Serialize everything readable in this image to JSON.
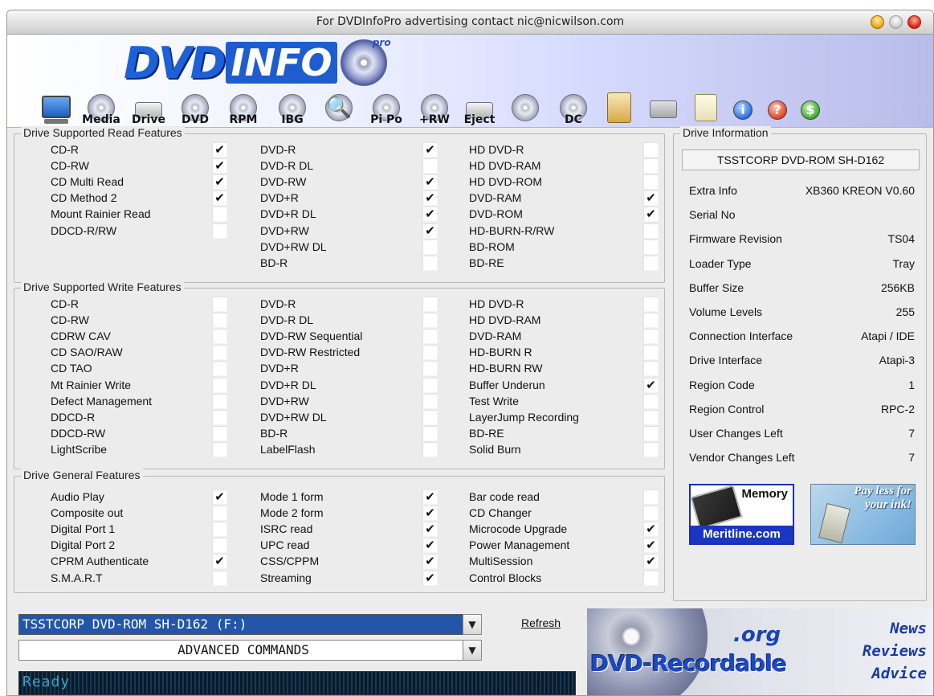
{
  "window": {
    "title": "For DVDInfoPro advertising contact nic@nicwilson.com"
  },
  "logo": {
    "dvd": "DVD",
    "info": "INFO",
    "pro": "pro"
  },
  "toolbar": {
    "media": "Media",
    "drive": "Drive",
    "dvd": "DVD",
    "rpm": "RPM",
    "ibg": "IBG",
    "pipo": "Pi Po",
    "rw": "+RW",
    "eject": "Eject",
    "dc": "DC"
  },
  "read": {
    "title": "Drive Supported Read Features",
    "col1": [
      {
        "label": "CD-R",
        "checked": true
      },
      {
        "label": "CD-RW",
        "checked": true
      },
      {
        "label": "CD Multi Read",
        "checked": true
      },
      {
        "label": "CD Method 2",
        "checked": true
      },
      {
        "label": "Mount Rainier Read",
        "checked": false
      },
      {
        "label": "DDCD-R/RW",
        "checked": false
      }
    ],
    "col2": [
      {
        "label": "DVD-R",
        "checked": true
      },
      {
        "label": "DVD-R DL",
        "checked": false
      },
      {
        "label": "DVD-RW",
        "checked": true
      },
      {
        "label": "DVD+R",
        "checked": true
      },
      {
        "label": "DVD+R DL",
        "checked": true
      },
      {
        "label": "DVD+RW",
        "checked": true
      },
      {
        "label": "DVD+RW DL",
        "checked": false
      },
      {
        "label": "BD-R",
        "checked": false
      }
    ],
    "col3": [
      {
        "label": "HD DVD-R",
        "checked": false
      },
      {
        "label": "HD DVD-RAM",
        "checked": false
      },
      {
        "label": "HD DVD-ROM",
        "checked": false
      },
      {
        "label": "DVD-RAM",
        "checked": true
      },
      {
        "label": "DVD-ROM",
        "checked": true
      },
      {
        "label": "HD-BURN-R/RW",
        "checked": false
      },
      {
        "label": "BD-ROM",
        "checked": false
      },
      {
        "label": "BD-RE",
        "checked": false
      }
    ]
  },
  "write": {
    "title": "Drive Supported Write Features",
    "col1": [
      {
        "label": "CD-R",
        "checked": false
      },
      {
        "label": "CD-RW",
        "checked": false
      },
      {
        "label": "CDRW CAV",
        "checked": false
      },
      {
        "label": "CD SAO/RAW",
        "checked": false
      },
      {
        "label": "CD TAO",
        "checked": false
      },
      {
        "label": "Mt Rainier Write",
        "checked": false
      },
      {
        "label": "Defect Management",
        "checked": false
      },
      {
        "label": "DDCD-R",
        "checked": false
      },
      {
        "label": "DDCD-RW",
        "checked": false
      },
      {
        "label": "LightScribe",
        "checked": false
      }
    ],
    "col2": [
      {
        "label": "DVD-R",
        "checked": false
      },
      {
        "label": "DVD-R DL",
        "checked": false
      },
      {
        "label": "DVD-RW Sequential",
        "checked": false
      },
      {
        "label": "DVD-RW Restricted",
        "checked": false
      },
      {
        "label": "DVD+R",
        "checked": false
      },
      {
        "label": "DVD+R DL",
        "checked": false
      },
      {
        "label": "DVD+RW",
        "checked": false
      },
      {
        "label": "DVD+RW DL",
        "checked": false
      },
      {
        "label": "BD-R",
        "checked": false
      },
      {
        "label": "LabelFlash",
        "checked": false
      }
    ],
    "col3": [
      {
        "label": "HD DVD-R",
        "checked": false
      },
      {
        "label": "HD DVD-RAM",
        "checked": false
      },
      {
        "label": "DVD-RAM",
        "checked": false
      },
      {
        "label": "HD-BURN R",
        "checked": false
      },
      {
        "label": "HD-BURN RW",
        "checked": false
      },
      {
        "label": "Buffer Underun",
        "checked": true
      },
      {
        "label": "Test Write",
        "checked": false
      },
      {
        "label": "LayerJump Recording",
        "checked": false
      },
      {
        "label": "BD-RE",
        "checked": false
      },
      {
        "label": "Solid Burn",
        "checked": false
      }
    ]
  },
  "general": {
    "title": "Drive General Features",
    "col1": [
      {
        "label": "Audio Play",
        "checked": true
      },
      {
        "label": "Composite out",
        "checked": false
      },
      {
        "label": "Digital Port 1",
        "checked": false
      },
      {
        "label": "Digital Port 2",
        "checked": false
      },
      {
        "label": "CPRM Authenticate",
        "checked": true
      },
      {
        "label": "S.M.A.R.T",
        "checked": false
      }
    ],
    "col2": [
      {
        "label": "Mode 1 form",
        "checked": true
      },
      {
        "label": "Mode 2 form",
        "checked": true
      },
      {
        "label": "ISRC read",
        "checked": true
      },
      {
        "label": "UPC read",
        "checked": true
      },
      {
        "label": "CSS/CPPM",
        "checked": true
      },
      {
        "label": "Streaming",
        "checked": true
      }
    ],
    "col3": [
      {
        "label": "Bar code read",
        "checked": false
      },
      {
        "label": "CD Changer",
        "checked": false
      },
      {
        "label": "Microcode Upgrade",
        "checked": true
      },
      {
        "label": "Power Management",
        "checked": true
      },
      {
        "label": "MultiSession",
        "checked": true
      },
      {
        "label": "Control Blocks",
        "checked": false
      }
    ]
  },
  "drive_info": {
    "title": "Drive Information",
    "model": "TSSTCORP DVD-ROM SH-D162",
    "rows": [
      {
        "key": "Extra Info",
        "value": "XB360 KREON V0.60"
      },
      {
        "key": "Serial No",
        "value": ""
      },
      {
        "key": "Firmware Revision",
        "value": "TS04"
      },
      {
        "key": "Loader Type",
        "value": "Tray"
      },
      {
        "key": "Buffer Size",
        "value": "256KB"
      },
      {
        "key": "Volume Levels",
        "value": "255"
      },
      {
        "key": "Connection Interface",
        "value": "Atapi / IDE"
      },
      {
        "key": "Drive Interface",
        "value": "Atapi-3"
      },
      {
        "key": "Region Code",
        "value": "1"
      },
      {
        "key": "Region Control",
        "value": "RPC-2"
      },
      {
        "key": "User Changes Left",
        "value": "7"
      },
      {
        "key": "Vendor Changes Left",
        "value": "7"
      }
    ]
  },
  "ads": {
    "memory_title": "Memory",
    "memory_site": "Meritline.com",
    "ink_line1": "Pay less for",
    "ink_line2": "your ink!"
  },
  "controls": {
    "drive_select": "TSSTCORP DVD-ROM SH-D162 (F:)",
    "command_select": "ADVANCED COMMANDS",
    "refresh": "Refresh",
    "status": "Ready"
  },
  "banner": {
    "org": ".org",
    "brand": "DVD-Recordable",
    "news": "News",
    "reviews": "Reviews",
    "advice": "Advice"
  }
}
